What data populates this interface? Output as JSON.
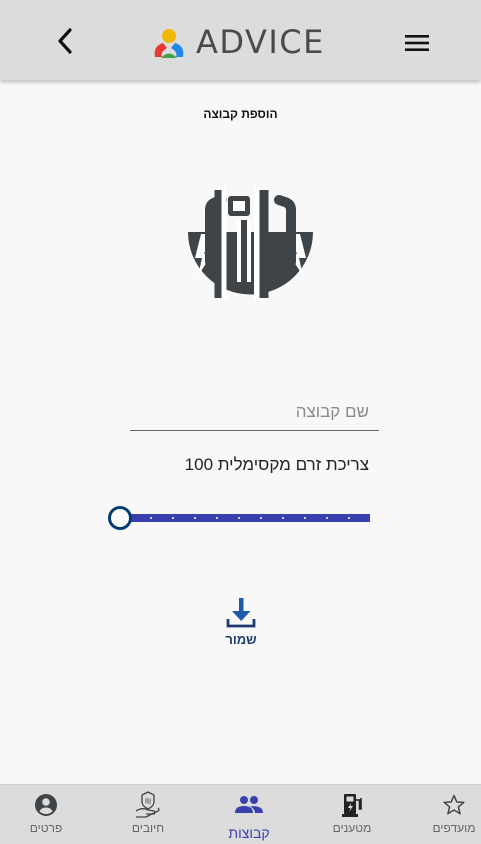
{
  "header": {
    "logo_text": "ADVICE",
    "colors": {
      "bar": "#dcdcdc",
      "logo_text": "#4a4a4a"
    }
  },
  "page": {
    "title": "הוספת קבוצה"
  },
  "form": {
    "group_name": {
      "value": "",
      "placeholder": "שם קבוצה"
    },
    "current_label": "צריכת זרם מקסימלית 100",
    "slider": {
      "value": 0,
      "min": 0,
      "max": 100
    },
    "save_label": "שמור"
  },
  "bottom_nav": {
    "items": [
      {
        "label": "מועדפים",
        "icon": "star-icon"
      },
      {
        "label": "מטענים",
        "icon": "charger-icon"
      },
      {
        "label": "קבוצות",
        "icon": "groups-icon",
        "active": true
      },
      {
        "label": "חיובים",
        "icon": "payment-icon"
      },
      {
        "label": "פרטים",
        "icon": "account-icon"
      }
    ]
  },
  "colors": {
    "accent": "#3a3fb0",
    "save": "#1e5aa8",
    "thumb_border": "#003c71",
    "icon_dark": "#3f4449"
  }
}
